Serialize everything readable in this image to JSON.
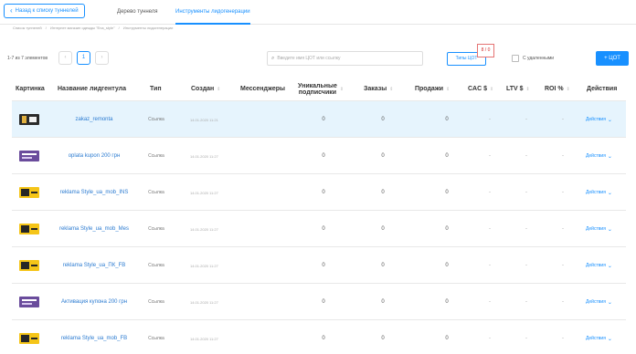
{
  "header": {
    "back_label": "Назад к списку туннелей",
    "tabs": [
      {
        "label": "Дерево туннеля",
        "active": false
      },
      {
        "label": "Инструменты лидогенерации",
        "active": true
      }
    ]
  },
  "breadcrumb": [
    "Список туннелей",
    "/",
    "Интернет магазин одежды \"Ena_style\"",
    "/",
    "Инструменты лидогенерации"
  ],
  "toolbar": {
    "counter": "1-7 из 7 элементов",
    "page": "1",
    "search_placeholder": "Введите имя ЦОТ или ссылку",
    "types_label": "Типы ЦОТ",
    "types_badge": "8 / 0",
    "deleted_label": "С удаленными",
    "add_label": "+ ЦОТ"
  },
  "colors": {
    "accent": "#1890ff",
    "highlight_row": "#e6f4fd",
    "badge_border": "#e57373"
  },
  "table": {
    "headers": {
      "picture": "Картинка",
      "name": "Название лидгентула",
      "type": "Тип",
      "created": "Создан",
      "messengers": "Мессенджеры",
      "unique_line1": "Уникальные",
      "unique_line2": "подписчики",
      "orders": "Заказы",
      "sales": "Продажи",
      "cac": "CAC $",
      "ltv": "LTV $",
      "roi": "ROI %",
      "actions": "Действия"
    },
    "rows": [
      {
        "thumb": "dark",
        "name": "zakaz_remonta",
        "type": "Ссылка",
        "created": "14.01.2020 11:21",
        "unique": "0",
        "orders": "0",
        "sales": "0",
        "cac": "-",
        "ltv": "-",
        "roi": "-",
        "action": "Действия"
      },
      {
        "thumb": "purple",
        "name": "oplata kupon 200 грн",
        "type": "Ссылка",
        "created": "14.01.2020 11:27",
        "unique": "0",
        "orders": "0",
        "sales": "0",
        "cac": "-",
        "ltv": "-",
        "roi": "-",
        "action": "Действия"
      },
      {
        "thumb": "yellow",
        "name": "reklama Style_ua_mob_INS",
        "type": "Ссылка",
        "created": "14.01.2020 11:27",
        "unique": "0",
        "orders": "0",
        "sales": "0",
        "cac": "-",
        "ltv": "-",
        "roi": "-",
        "action": "Действия"
      },
      {
        "thumb": "yellow",
        "name": "reklama Style_ua_mob_Mes",
        "type": "Ссылка",
        "created": "14.01.2020 11:27",
        "unique": "0",
        "orders": "0",
        "sales": "0",
        "cac": "-",
        "ltv": "-",
        "roi": "-",
        "action": "Действия"
      },
      {
        "thumb": "yellow",
        "name": "reklama Style_ua_ПК_FB",
        "type": "Ссылка",
        "created": "14.01.2020 11:27",
        "unique": "0",
        "orders": "0",
        "sales": "0",
        "cac": "-",
        "ltv": "-",
        "roi": "-",
        "action": "Действия"
      },
      {
        "thumb": "purple",
        "name": "Активация купона 200 грн",
        "type": "Ссылка",
        "created": "14.01.2020 11:27",
        "unique": "0",
        "orders": "0",
        "sales": "0",
        "cac": "-",
        "ltv": "-",
        "roi": "-",
        "action": "Действия"
      },
      {
        "thumb": "yellow",
        "name": "reklama Style_ua_mob_FB",
        "type": "Ссылка",
        "created": "14.01.2020 11:27",
        "unique": "0",
        "orders": "0",
        "sales": "0",
        "cac": "-",
        "ltv": "-",
        "roi": "-",
        "action": "Действия"
      }
    ]
  }
}
